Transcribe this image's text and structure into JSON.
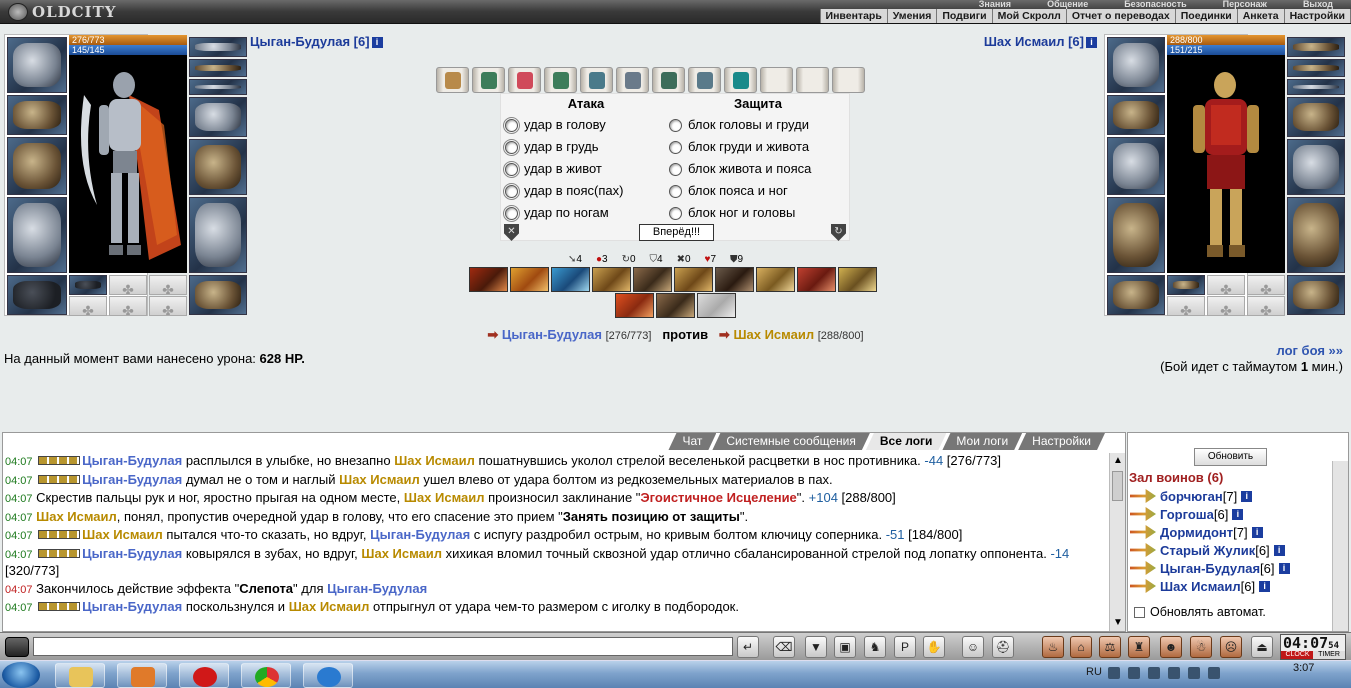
{
  "game": {
    "logo": "OLDCITY",
    "top_menu": [
      "Знания",
      "Общение",
      "Безопасность",
      "Персонаж",
      "Выход"
    ],
    "sub_menu": [
      "Инвентарь",
      "Умения",
      "Подвиги",
      "Мой Скролл",
      "Отчет о переводах",
      "Поединки",
      "Анкета",
      "Настройки"
    ]
  },
  "player_left": {
    "name": "Цыган-Будулая [6]",
    "info_icon": "i",
    "hp": "276/773",
    "mp": "145/145",
    "hp_fraction": 0.357,
    "mp_fraction": 1.0
  },
  "player_right": {
    "name": "Шах Исмаил [6]",
    "info_icon": "i",
    "hp": "288/800",
    "mp": "151/215",
    "hp_fraction": 0.36,
    "mp_fraction": 0.702
  },
  "fight": {
    "attack_title": "Атака",
    "defense_title": "Защита",
    "attacks": [
      "удар в голову",
      "удар в грудь",
      "удар в живот",
      "удар в пояс(пах)",
      "удар по ногам"
    ],
    "defenses": [
      "блок головы и груди",
      "блок груди и живота",
      "блок живота и пояса",
      "блок пояса и ног",
      "блок ног и головы"
    ],
    "go_button": "Вперёд!!!"
  },
  "counters": [
    {
      "icon": "arrow-icon",
      "glyph": "➘",
      "value": "4"
    },
    {
      "icon": "blood-icon",
      "glyph": "●",
      "value": "3"
    },
    {
      "icon": "swirl-icon",
      "glyph": "↻",
      "value": "0"
    },
    {
      "icon": "shield-icon",
      "glyph": "⛉",
      "value": "4"
    },
    {
      "icon": "cross-icon",
      "glyph": "✖",
      "value": "0"
    },
    {
      "icon": "heart-icon",
      "glyph": "♥",
      "value": "7"
    },
    {
      "icon": "armor-icon",
      "glyph": "⛊",
      "value": "9"
    }
  ],
  "vs_line": {
    "left_name": "Цыган-Будулая",
    "left_hp": "[276/773]",
    "versus": "против",
    "right_name": "Шах Исмаил",
    "right_hp": "[288/800]"
  },
  "damage": {
    "text": "На данный момент вами нанесено урона: ",
    "value": "628 HP."
  },
  "battle_log_link": "лог боя »»",
  "timeout": {
    "prefix": "(Бой идет с таймаутом ",
    "value": "1",
    "suffix": " мин.)"
  },
  "chat_tabs": [
    "Чат",
    "Системные сообщения",
    "Все логи",
    "Мои логи",
    "Настройки"
  ],
  "chat_active_tab": "Все логи",
  "log": [
    {
      "time": "04:07",
      "red": false,
      "parts": [
        {
          "t": "sq"
        },
        {
          "t": "n1",
          "v": "Цыган-Будулая"
        },
        {
          "t": "tx",
          "v": " расплылся в улыбке, но внезапно "
        },
        {
          "t": "n2",
          "v": "Шах Исмаил"
        },
        {
          "t": "tx",
          "v": " пошатнувшись уколол стрелой веселенькой расцветки в нос противника. "
        },
        {
          "t": "mn",
          "v": "-44"
        },
        {
          "t": "tx",
          "v": " [276/773]"
        }
      ]
    },
    {
      "time": "04:07",
      "red": false,
      "parts": [
        {
          "t": "sq"
        },
        {
          "t": "n1",
          "v": "Цыган-Будулая"
        },
        {
          "t": "tx",
          "v": " думал не о том и наглый "
        },
        {
          "t": "n2",
          "v": "Шах Исмаил"
        },
        {
          "t": "tx",
          "v": " ушел влево от удара болтом из редкоземельных материалов в пах."
        }
      ]
    },
    {
      "time": "04:07",
      "red": false,
      "parts": [
        {
          "t": "tx",
          "v": "Скрестив пальцы рук и ног, яростно прыгая на одном месте, "
        },
        {
          "t": "n2",
          "v": "Шах Исмаил"
        },
        {
          "t": "tx",
          "v": " произносил заклинание \""
        },
        {
          "t": "sk",
          "v": "Эгоистичное Исцеление"
        },
        {
          "t": "tx",
          "v": "\". "
        },
        {
          "t": "mn",
          "v": "+104"
        },
        {
          "t": "tx",
          "v": " [288/800]"
        }
      ]
    },
    {
      "time": "04:07",
      "red": false,
      "parts": [
        {
          "t": "n2",
          "v": "Шах Исмаил"
        },
        {
          "t": "tx",
          "v": ", понял, пропустив очередной удар в голову, что его спасение это прием \""
        },
        {
          "t": "b",
          "v": "Занять позицию от защиты"
        },
        {
          "t": "tx",
          "v": "\"."
        }
      ]
    },
    {
      "time": "04:07",
      "red": false,
      "parts": [
        {
          "t": "sq"
        },
        {
          "t": "n2",
          "v": "Шах Исмаил"
        },
        {
          "t": "tx",
          "v": " пытался что-то сказать, но вдруг, "
        },
        {
          "t": "n1",
          "v": "Цыган-Будулая"
        },
        {
          "t": "tx",
          "v": " с испугу раздробил острым, но кривым болтом ключицу соперника. "
        },
        {
          "t": "mn",
          "v": "-51"
        },
        {
          "t": "tx",
          "v": " [184/800]"
        }
      ]
    },
    {
      "time": "04:07",
      "red": false,
      "parts": [
        {
          "t": "sq"
        },
        {
          "t": "n1",
          "v": "Цыган-Будулая"
        },
        {
          "t": "tx",
          "v": " ковырялся в зубах, но вдруг, "
        },
        {
          "t": "n2",
          "v": "Шах Исмаил"
        },
        {
          "t": "tx",
          "v": " хихикая вломил точный сквозной удар отлично сбалансированной стрелой под лопатку оппонента. "
        },
        {
          "t": "mn",
          "v": "-14"
        },
        {
          "t": "tx",
          "v": " [320/773]"
        }
      ]
    },
    {
      "time": "04:07",
      "red": true,
      "parts": [
        {
          "t": "tx",
          "v": "Закончилось действие эффекта \""
        },
        {
          "t": "b",
          "v": "Слепота"
        },
        {
          "t": "tx",
          "v": "\" для "
        },
        {
          "t": "n1",
          "v": "Цыган-Будулая"
        }
      ]
    },
    {
      "time": "04:07",
      "red": false,
      "parts": [
        {
          "t": "sq"
        },
        {
          "t": "n1",
          "v": "Цыган-Будулая"
        },
        {
          "t": "tx",
          "v": " поскользнулся и "
        },
        {
          "t": "n2",
          "v": "Шах Исмаил"
        },
        {
          "t": "tx",
          "v": " отпрыгнул от удара чем-то размером с иголку в подбородок."
        }
      ]
    }
  ],
  "side": {
    "refresh_button": "Обновить",
    "room_title": "Зал воинов (6)",
    "players": [
      {
        "name": "борчюган",
        "level": "[7]"
      },
      {
        "name": "Горгоша",
        "level": "[6]"
      },
      {
        "name": "Дормидонт",
        "level": "[7]"
      },
      {
        "name": "Старый Жулик",
        "level": "[6]"
      },
      {
        "name": "Цыган-Будулая",
        "level": "[6]"
      },
      {
        "name": "Шах Исмаил",
        "level": "[6]"
      }
    ],
    "auto_update": "Обновлять автомат."
  },
  "clock": {
    "time": "04:07",
    "seconds": "54",
    "clock_label": "CLOCK",
    "timer_label": "TIMER"
  },
  "taskbar": {
    "lang": "RU",
    "time": "3:07"
  }
}
